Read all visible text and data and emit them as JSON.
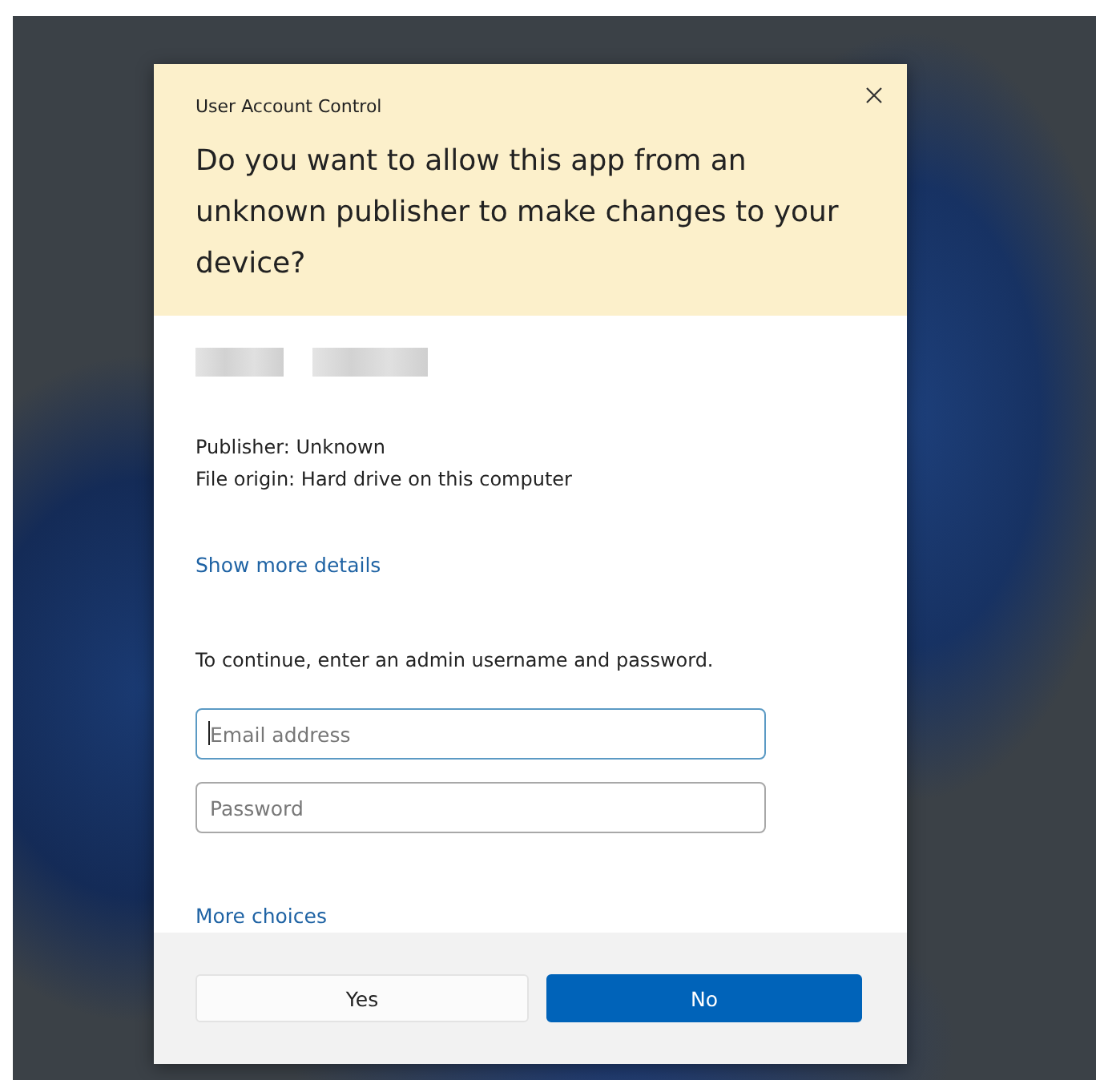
{
  "dialog": {
    "title": "User Account Control",
    "question": "Do you want to allow this app from an unknown publisher to make changes to your device?",
    "details": [
      "Publisher: Unknown",
      "File origin: Hard drive on this computer"
    ],
    "details_link": "Show more details",
    "instruction": "To continue, enter an admin username and password.",
    "fields": [
      {
        "placeholder": "Email address",
        "focused": true
      },
      {
        "placeholder": "Password",
        "focused": false
      }
    ],
    "more_link": "More choices",
    "buttons": [
      {
        "label": "Yes",
        "primary": false
      },
      {
        "label": "No",
        "primary": true
      }
    ]
  }
}
